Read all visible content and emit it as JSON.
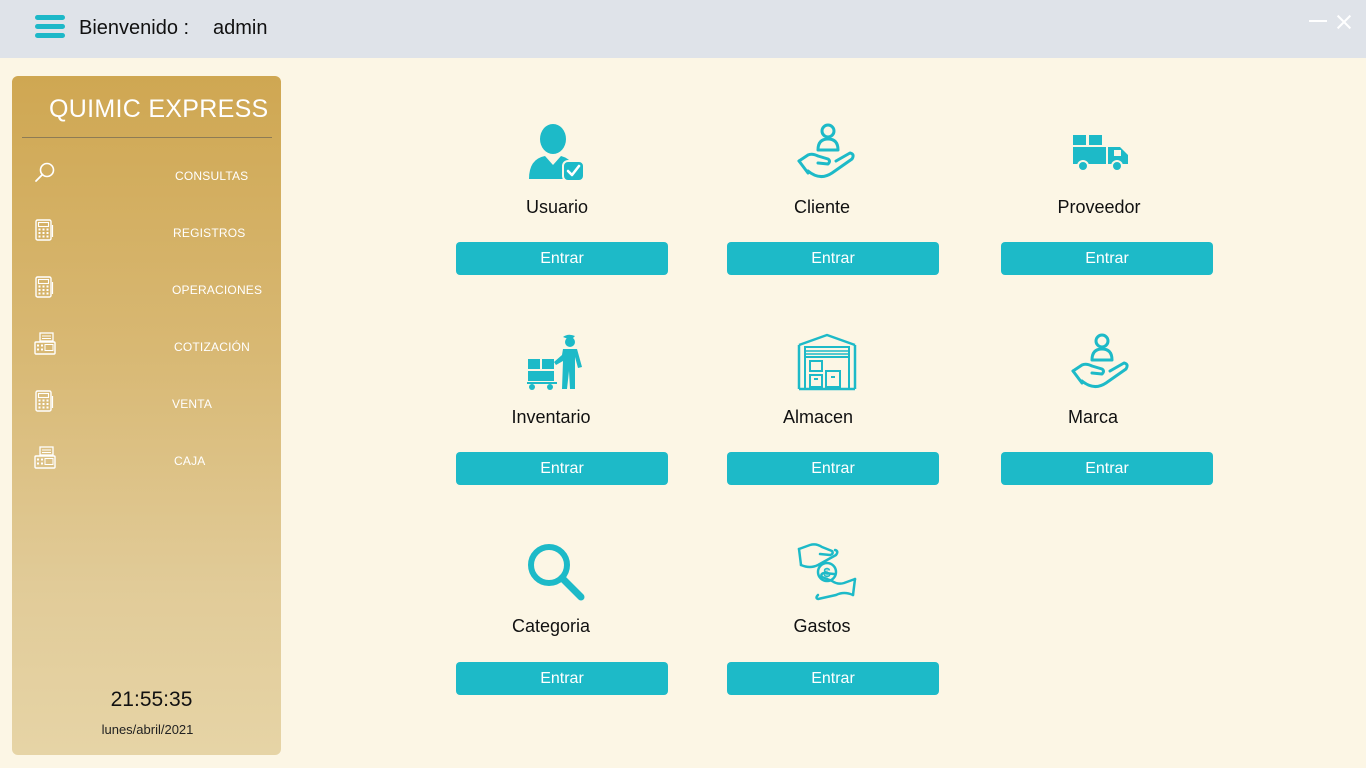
{
  "header": {
    "welcome": "Bienvenido :",
    "user": "admin",
    "menu_icon": "hamburger-menu-icon",
    "minimize_icon": "minimize-icon",
    "close_icon": "close-icon",
    "bar_color": "#dfe3e9",
    "accent_color": "#1db8c8"
  },
  "sidebar": {
    "brand": "QUIMIC EXPRESS",
    "items": [
      {
        "label": "CONSULTAS",
        "icon": "search-icon"
      },
      {
        "label": "REGISTROS",
        "icon": "calculator-icon"
      },
      {
        "label": "OPERACIONES",
        "icon": "calculator-icon"
      },
      {
        "label": "COTIZACIÓN",
        "icon": "cash-register-icon"
      },
      {
        "label": "VENTA",
        "icon": "calculator-icon"
      },
      {
        "label": "CAJA",
        "icon": "cash-register-icon"
      }
    ],
    "time": "21:55:35",
    "date": "lunes/abril/2021",
    "gradient_top": "#cfa752",
    "gradient_bottom": "#e6d4a6"
  },
  "modules": [
    {
      "title": "Usuario",
      "button": "Entrar",
      "icon": "user-check-icon"
    },
    {
      "title": "Cliente",
      "button": "Entrar",
      "icon": "client-hand-icon"
    },
    {
      "title": "Proveedor",
      "button": "Entrar",
      "icon": "delivery-truck-icon"
    },
    {
      "title": "Inventario",
      "button": "Entrar",
      "icon": "worker-cart-icon"
    },
    {
      "title": "Almacen",
      "button": "Entrar",
      "icon": "warehouse-icon"
    },
    {
      "title": "Marca",
      "button": "Entrar",
      "icon": "brand-hand-icon"
    },
    {
      "title": "Categoria",
      "button": "Entrar",
      "icon": "magnifier-icon"
    },
    {
      "title": "Gastos",
      "button": "Entrar",
      "icon": "money-exchange-icon"
    }
  ],
  "colors": {
    "background": "#fcf6e5",
    "button": "#1dbac8"
  }
}
